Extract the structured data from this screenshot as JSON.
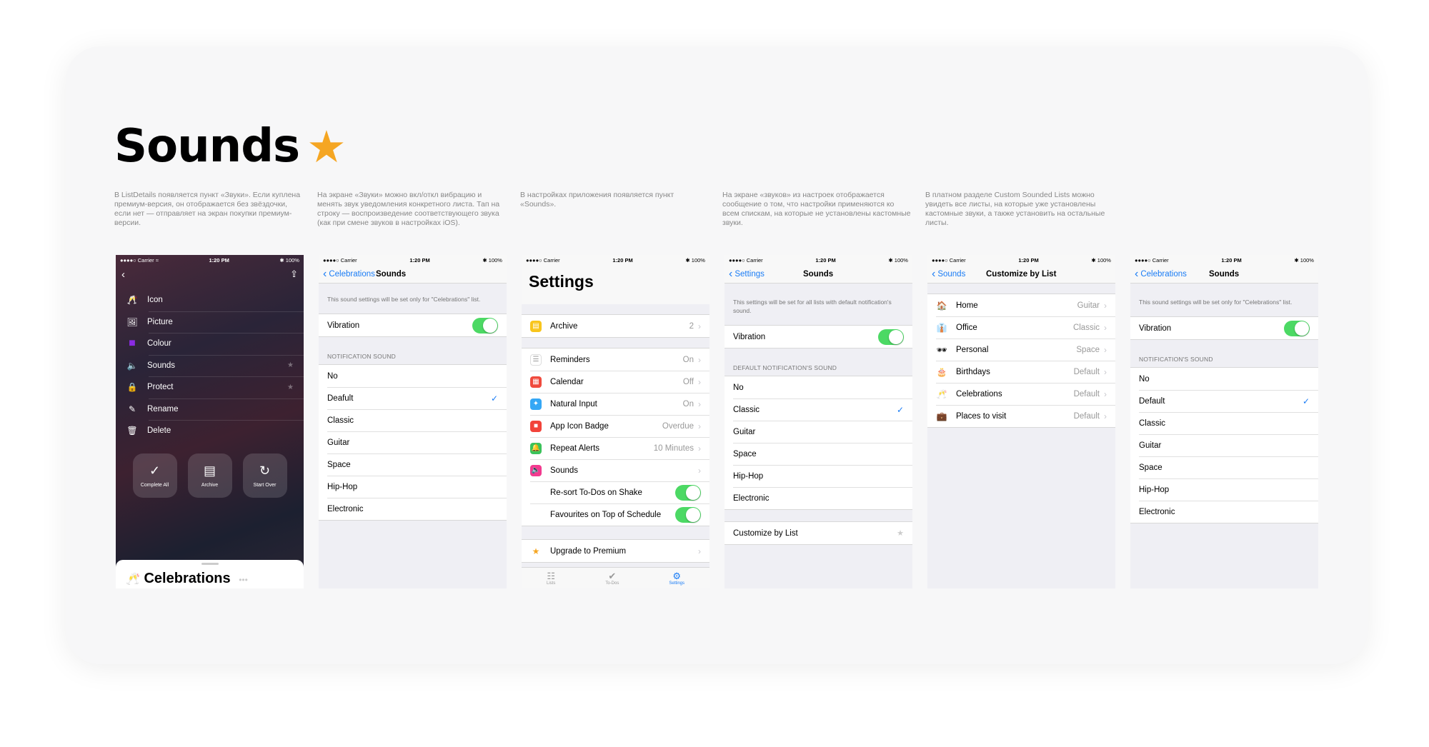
{
  "header": {
    "title": "Sounds",
    "star": "★"
  },
  "descriptions": [
    "В ListDetails появляется пункт «Звуки». Если куплена премиум-версия, он отображается без звёздочки, если нет — отправляет на экран покупки премиум-версии.",
    "На экране «Звуки» можно вкл/откл вибрацию и менять звук уведомления конкретного листа. Тап на строку — воспроизведение соответствующего звука (как при смене звуков в настройках iOS).",
    "В настройках приложения появляется пункт «Sounds».",
    "На экране «звуков» из настроек отображается сообщение о том, что настройки применяются ко всем спискам, на которые не установлены кастомные звуки.",
    "В платном разделе Custom Sounded Lists можно увидеть все листы, на которые уже установлены кастомные звуки, а также установить на остальные листы."
  ],
  "status": {
    "carrier": "●●●●○ Carrier",
    "wifi": "≈",
    "time": "1:20 PM",
    "battery": "✱ 100%"
  },
  "screen1": {
    "menu": [
      {
        "icon": "🥂",
        "label": "Icon",
        "star": false
      },
      {
        "icon": "🖼",
        "label": "Picture",
        "star": false
      },
      {
        "icon": "■",
        "label": "Colour",
        "star": false
      },
      {
        "icon": "🔈",
        "label": "Sounds",
        "star": true
      },
      {
        "icon": "🔒",
        "label": "Protect",
        "star": true
      },
      {
        "icon": "✎",
        "label": "Rename",
        "star": false
      },
      {
        "icon": "🗑",
        "label": "Delete",
        "star": false
      }
    ],
    "buttons": [
      {
        "icon": "✓",
        "label": "Complete All"
      },
      {
        "icon": "▤",
        "label": "Archive"
      },
      {
        "icon": "↻",
        "label": "Start Over"
      }
    ],
    "sheet_title": "Celebrations",
    "sheet_emoji": "🥂",
    "sheet_dots": "•••"
  },
  "screen2": {
    "back": "Celebrations",
    "title": "Sounds",
    "note": "This sound settings will be set only for \"Celebrations\" list.",
    "vibration": "Vibration",
    "section": "NOTIFICATION SOUND",
    "sounds": [
      "No",
      "Deafult",
      "Classic",
      "Guitar",
      "Space",
      "Hip-Hop",
      "Electronic"
    ],
    "checked": "✓"
  },
  "screen3": {
    "title": "Settings",
    "archive": {
      "label": "Archive",
      "value": "2"
    },
    "items": [
      {
        "label": "Reminders",
        "value": "On",
        "color": "#ffffff",
        "icon": "☰"
      },
      {
        "label": "Calendar",
        "value": "Off",
        "color": "#f04a3d",
        "icon": "▦"
      },
      {
        "label": "Natural Input",
        "value": "On",
        "color": "#35a7f5",
        "icon": "✦"
      },
      {
        "label": "App Icon Badge",
        "value": "Overdue",
        "color": "#f2433a",
        "icon": "■"
      },
      {
        "label": "Repeat Alerts",
        "value": "10 Minutes",
        "color": "#3bc25a",
        "icon": "🔔"
      },
      {
        "label": "Sounds",
        "value": "",
        "color": "#f23a8f",
        "icon": "🔈"
      }
    ],
    "toggles": [
      "Re-sort To-Dos on Shake",
      "Favourites on Top of Schedule"
    ],
    "upgrade": "Upgrade to Premium",
    "tabs": [
      {
        "icon": "☷",
        "label": "Lists"
      },
      {
        "icon": "✔",
        "label": "To-Dos"
      },
      {
        "icon": "⚙",
        "label": "Settings"
      }
    ]
  },
  "screen4": {
    "back": "Settings",
    "title": "Sounds",
    "note": "This settings will be set for all lists with default notification's sound.",
    "vibration": "Vibration",
    "section": "DEFAULT NOTIFICATION'S SOUND",
    "sounds": [
      "No",
      "Classic",
      "Guitar",
      "Space",
      "Hip-Hop",
      "Electronic"
    ],
    "checked": "✓",
    "customize": "Customize by List"
  },
  "screen5": {
    "back": "Sounds",
    "title": "Customize by List",
    "lists": [
      {
        "emoji": "🏠",
        "label": "Home",
        "value": "Guitar"
      },
      {
        "emoji": "👔",
        "label": "Office",
        "value": "Classic"
      },
      {
        "emoji": "🕶",
        "label": "Personal",
        "value": "Space"
      },
      {
        "emoji": "🎂",
        "label": "Birthdays",
        "value": "Default"
      },
      {
        "emoji": "🥂",
        "label": "Celebrations",
        "value": "Default"
      },
      {
        "emoji": "💼",
        "label": "Places to visit",
        "value": "Default"
      }
    ]
  },
  "screen6": {
    "back": "Celebrations",
    "title": "Sounds",
    "note": "This sound settings will be set only for \"Celebrations\" list.",
    "vibration": "Vibration",
    "section": "NOTIFICATION'S SOUND",
    "sounds": [
      "No",
      "Default",
      "Classic",
      "Guitar",
      "Space",
      "Hip-Hop",
      "Electronic"
    ],
    "checked": "✓"
  }
}
